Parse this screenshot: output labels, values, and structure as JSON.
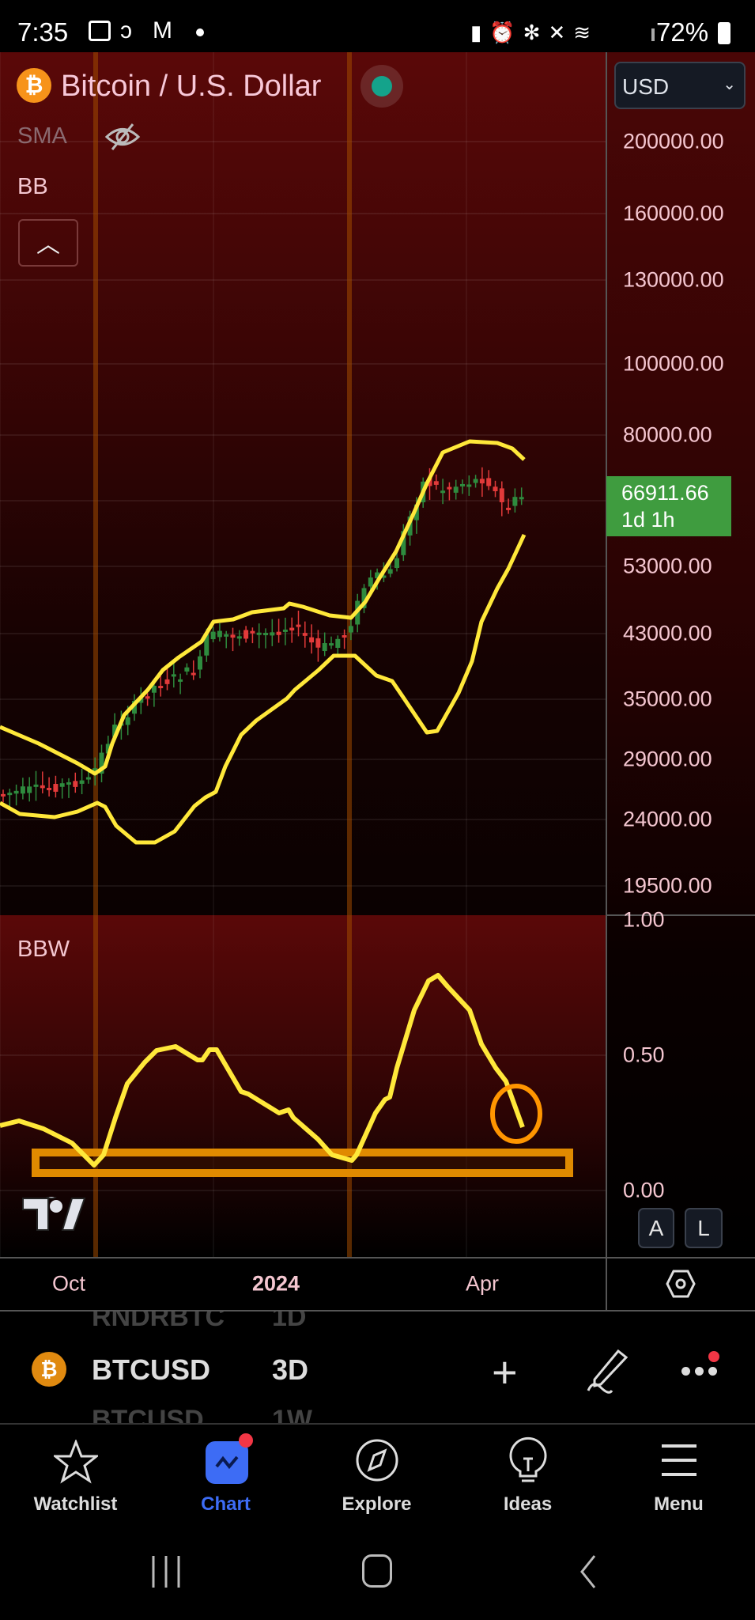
{
  "status_bar": {
    "time": "7:35",
    "battery": "72%"
  },
  "header": {
    "symbol_name": "Bitcoin / U.S. Dollar",
    "currency": "USD",
    "indicators": [
      "SMA",
      "BB"
    ]
  },
  "price_axis": [
    "200000.00",
    "160000.00",
    "130000.00",
    "100000.00",
    "80000.00",
    "53000.00",
    "43000.00",
    "35000.00",
    "29000.00",
    "24000.00",
    "19500.00"
  ],
  "last_price": {
    "value": "66911.66",
    "countdown": "1d 1h",
    "color": "#3f9c3f"
  },
  "bbw_pane": {
    "label": "BBW",
    "axis": [
      "1.00",
      "0.50",
      "0.00"
    ]
  },
  "scale_buttons": {
    "auto": "A",
    "log": "L"
  },
  "time_axis": [
    "Oct",
    "2024",
    "Apr"
  ],
  "symbol_bar": {
    "prev": "RNDRBTC",
    "prev_tf": "1D",
    "symbol": "BTCUSD",
    "timeframe": "3D",
    "next": "BTCUSD",
    "next_tf": "1W"
  },
  "bottom_nav": [
    {
      "label": "Watchlist"
    },
    {
      "label": "Chart"
    },
    {
      "label": "Explore"
    },
    {
      "label": "Ideas"
    },
    {
      "label": "Menu"
    }
  ],
  "colors": {
    "band": "#ffe83a",
    "up": "#2e8b3e",
    "down": "#e23a3a",
    "highlight": "#e08a00",
    "active": "#3d6cf5"
  }
}
